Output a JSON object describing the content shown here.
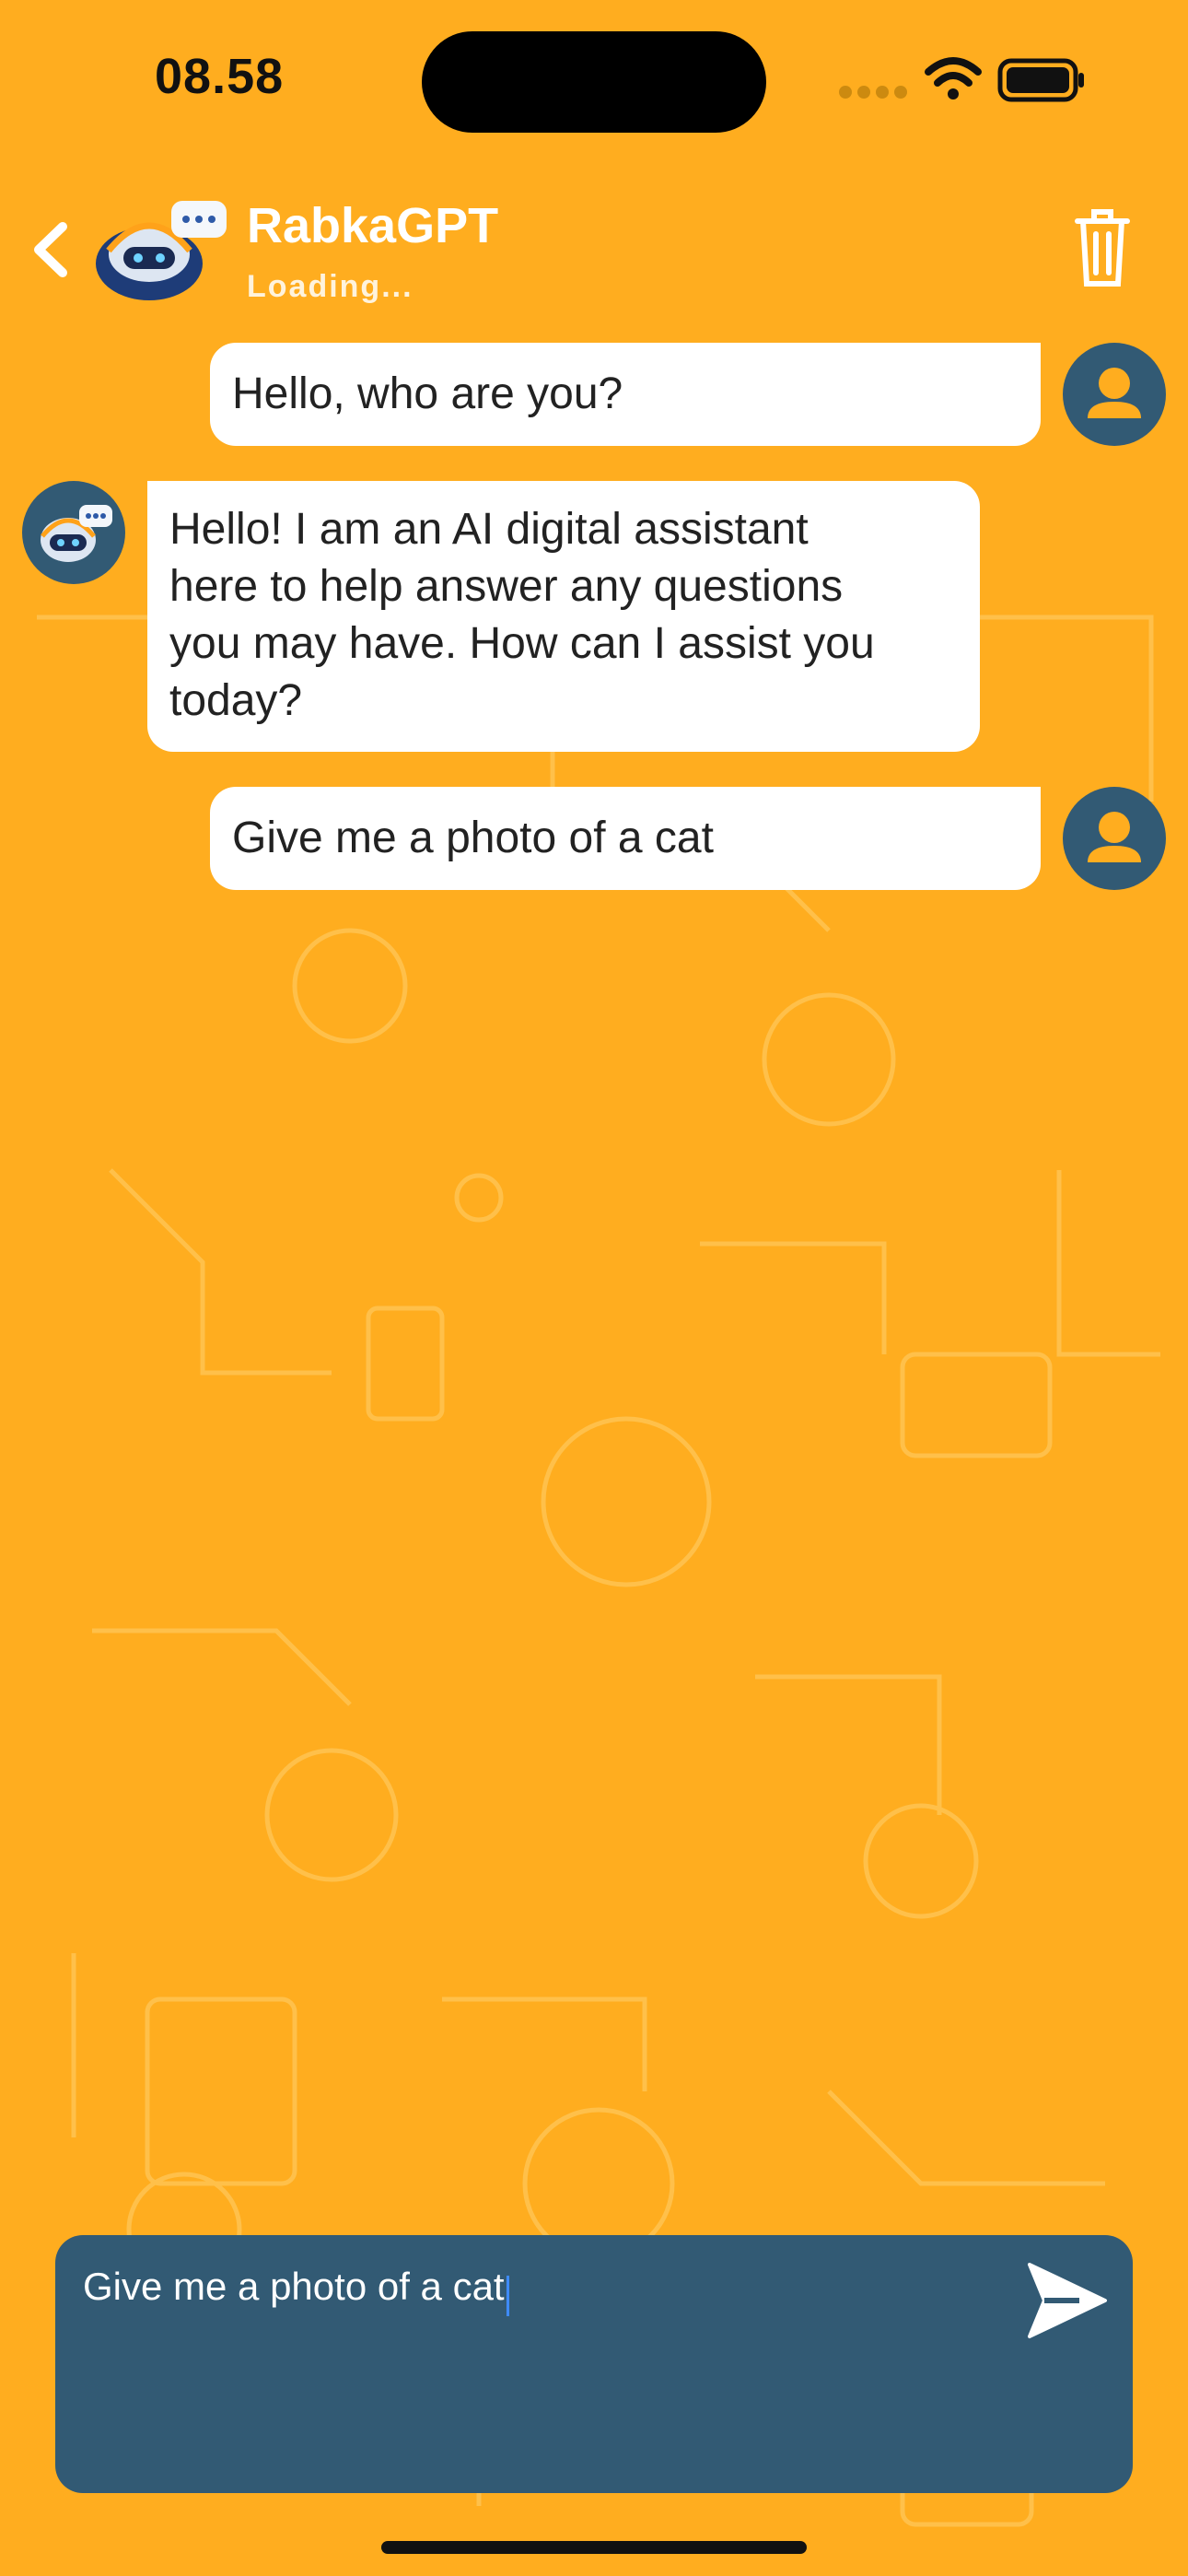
{
  "status_bar": {
    "time": "08.58",
    "icons": [
      "cellular-dots-icon",
      "wifi-icon",
      "battery-icon"
    ]
  },
  "header": {
    "title": "RabkaGPT",
    "subtitle": "Loading...",
    "back_icon": "chevron-left-icon",
    "delete_icon": "trash-icon"
  },
  "messages": [
    {
      "role": "user",
      "text": "Hello, who are you?"
    },
    {
      "role": "assistant",
      "text": "Hello! I am an AI digital assistant\nhere to help answer any questions\nyou may have. How can I assist you\ntoday?"
    },
    {
      "role": "user",
      "text": "Give me a photo of a cat"
    }
  ],
  "composer": {
    "value": "Give me a photo of a cat",
    "send_icon": "send-icon"
  },
  "colors": {
    "background": "#FFAD1F",
    "accent": "#325A74",
    "bubble": "#FFFFFF",
    "pattern": "#FFC24D"
  }
}
